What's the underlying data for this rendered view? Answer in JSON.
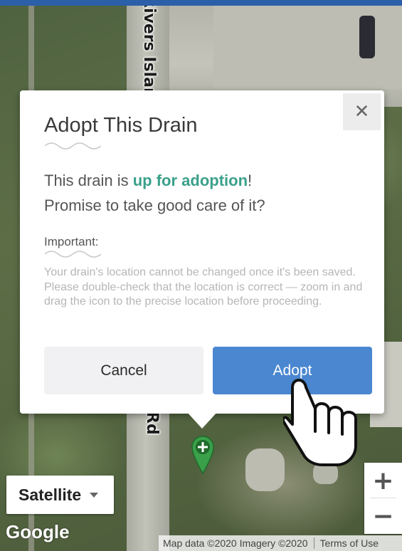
{
  "map": {
    "street_top": "Rivers Islan",
    "street_bottom": "Rd",
    "map_type": "Satellite",
    "zoom_in": "+",
    "zoom_out": "−",
    "logo": "Google",
    "attribution": "Map data ©2020 Imagery ©2020",
    "terms": "Terms of Use"
  },
  "modal": {
    "title": "Adopt This Drain",
    "close_icon": "close-icon",
    "line1_prefix": "This drain is ",
    "line1_highlight": "up for adoption",
    "line1_suffix": "!",
    "line2": "Promise to take good care of it?",
    "important_label": "Important:",
    "warning": "Your drain's location cannot be changed once it's been saved. Please double-check that the location is correct — zoom in and drag the icon to the precise location before proceeding.",
    "cancel_label": "Cancel",
    "adopt_label": "Adopt"
  },
  "colors": {
    "accent": "#4a87d0",
    "highlight": "#3aa08a",
    "pin": "#3aa04a"
  },
  "icons": [
    "close-icon",
    "pointer-hand-icon",
    "drain-pin-icon",
    "caret-down-icon"
  ]
}
